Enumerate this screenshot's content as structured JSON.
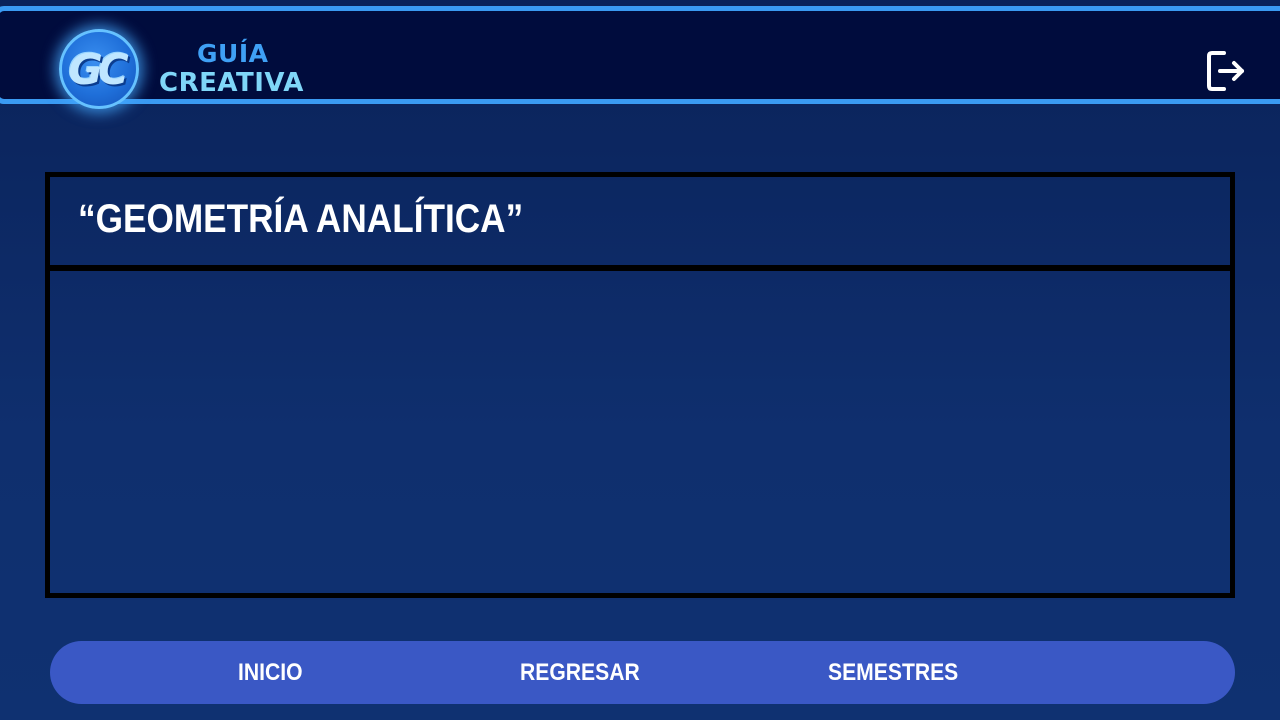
{
  "header": {
    "logo_text": "GC",
    "brand_line1": "GUÍA",
    "brand_line2": "CREATIVA",
    "logout_icon": "logout-icon"
  },
  "main": {
    "title": "“GEOMETRÍA ANALÍTICA”"
  },
  "nav": {
    "items": [
      {
        "label": "INICIO"
      },
      {
        "label": "REGRESAR"
      },
      {
        "label": "SEMESTRES"
      }
    ]
  },
  "colors": {
    "background": "#0d2a66",
    "header_bg": "#000c3d",
    "header_border": "#3a9af2",
    "brand_line1": "#3fa0f5",
    "brand_line2": "#7fd6f8",
    "nav_bg": "#3a58c5"
  }
}
